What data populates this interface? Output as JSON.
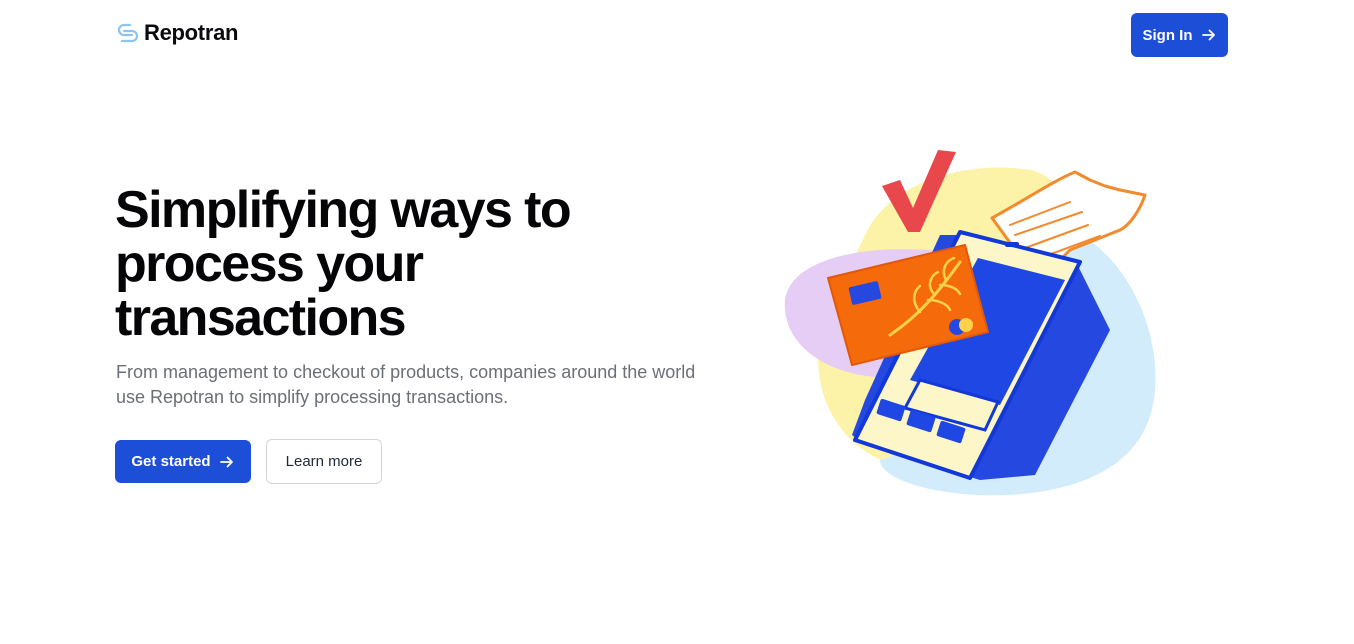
{
  "brand": {
    "name": "Repotran",
    "logo_icon": "link-swirl-icon",
    "logo_color": "#8ec5f0"
  },
  "nav": {
    "signin_label": "Sign In",
    "signin_icon": "arrow-right-icon"
  },
  "hero": {
    "title": "Simplifying ways to process your transactions",
    "subtitle": "From management to checkout of products, companies around the world use Repotran to simplify processing transactions.",
    "primary_cta": "Get started",
    "primary_cta_icon": "arrow-right-icon",
    "secondary_cta": "Learn more"
  },
  "illustration": {
    "subject": "payment-terminal-illustration",
    "elements": [
      "checkmark-icon",
      "credit-card-icon",
      "receipt-icon",
      "payment-terminal-icon"
    ]
  },
  "colors": {
    "primary": "#1d4ed8",
    "text": "#050507",
    "muted_text": "#6b6f76",
    "border": "#d1d5db",
    "check_red": "#e8474b",
    "card_orange": "#f56a0a",
    "blob_yellow": "#fdf3a8",
    "blob_blue": "#d3ecfb",
    "blob_purple": "#e6cdf5"
  }
}
